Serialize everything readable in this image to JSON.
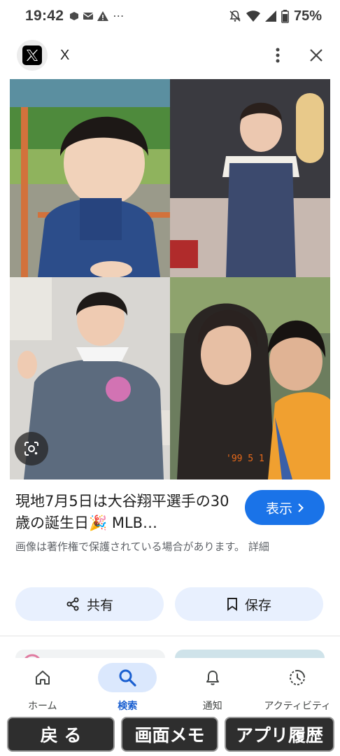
{
  "status_bar": {
    "time": "19:42",
    "battery": "75%"
  },
  "header": {
    "app_name": "X",
    "more_icon": "more-vert-icon",
    "close_icon": "close-icon"
  },
  "image": {
    "lens_icon": "lens-icon",
    "photo_stamp": "'99  5 1"
  },
  "result": {
    "title": "現地7月5日は大谷翔平選手の30歳の誕生日🎉 MLB…",
    "view_button": "表示",
    "copyright": "画像は著作権で保護されている場合があります。 詳細"
  },
  "actions": {
    "share": "共有",
    "save": "保存"
  },
  "bottom_nav": {
    "items": [
      {
        "label": "ホーム",
        "icon": "home-icon"
      },
      {
        "label": "検索",
        "icon": "search-icon"
      },
      {
        "label": "通知",
        "icon": "bell-icon"
      },
      {
        "label": "アクティビティ",
        "icon": "activity-icon"
      }
    ]
  },
  "system_buttons": {
    "back": "戻 る",
    "screen_memo": "画面メモ",
    "app_history": "アプリ履歴"
  },
  "colors": {
    "accent": "#1a73e8",
    "chip_bg": "#e8f0fe",
    "nav_active_bg": "#dbe8fd"
  }
}
